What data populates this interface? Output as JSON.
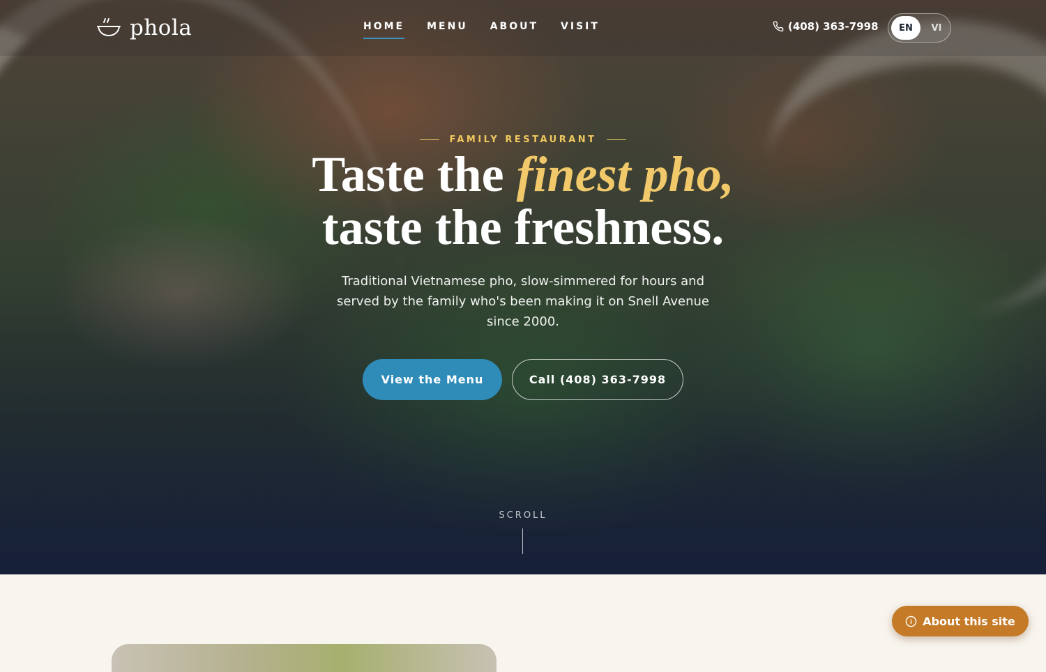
{
  "brand": {
    "logo_icon": "pho-bowl-icon",
    "name": "phola"
  },
  "nav": {
    "items": [
      {
        "label": "HOME",
        "active": true
      },
      {
        "label": "MENU",
        "active": false
      },
      {
        "label": "ABOUT",
        "active": false
      },
      {
        "label": "VISIT",
        "active": false
      }
    ]
  },
  "header": {
    "phone_icon": "phone-icon",
    "phone": "(408) 363-7998",
    "languages": [
      {
        "code": "EN",
        "selected": true
      },
      {
        "code": "VI",
        "selected": false
      }
    ]
  },
  "hero": {
    "eyebrow": "FAMILY RESTAURANT",
    "headline_part1": "Taste the ",
    "headline_accent": "finest pho,",
    "headline_part2": "taste the freshness.",
    "subtitle": "Traditional Vietnamese pho, slow-simmered for hours and served by the family who's been making it on Snell Avenue since 2000.",
    "primary_cta": "View the Menu",
    "secondary_cta": "Call (408) 363-7998",
    "scroll_label": "SCROLL"
  },
  "floating": {
    "about_label": "About this site",
    "about_icon": "info-icon"
  },
  "colors": {
    "accent_blue": "#2f8cb9",
    "accent_gold": "#f1c96a",
    "about_orange": "#c47a26",
    "page_background": "#f8f5ef"
  }
}
